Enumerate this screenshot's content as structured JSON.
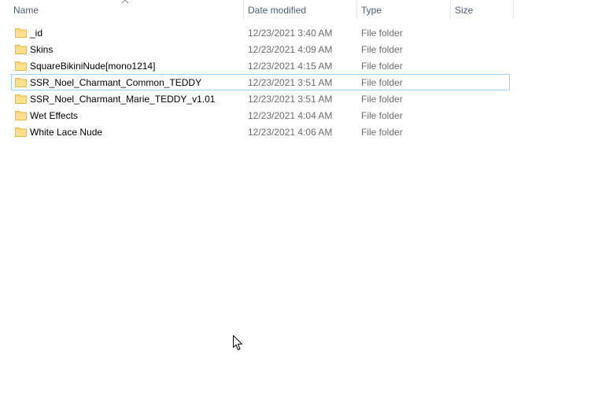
{
  "columns": {
    "name": "Name",
    "date": "Date modified",
    "type": "Type",
    "size": "Size"
  },
  "sort": {
    "column": "name",
    "direction": "ascending",
    "icon": "chevron-up-icon"
  },
  "folder_icon_color": "#ffd86b",
  "rows": [
    {
      "name": "_id",
      "date": "12/23/2021 3:40 AM",
      "type": "File folder",
      "size": ""
    },
    {
      "name": "Skins",
      "date": "12/23/2021 4:09 AM",
      "type": "File folder",
      "size": ""
    },
    {
      "name": "SquareBikiniNude[mono1214]",
      "date": "12/23/2021 4:15 AM",
      "type": "File folder",
      "size": ""
    },
    {
      "name": "SSR_Noel_Charmant_Common_TEDDY",
      "date": "12/23/2021 3:51 AM",
      "type": "File folder",
      "size": ""
    },
    {
      "name": "SSR_Noel_Charmant_Marie_TEDDY_v1.01",
      "date": "12/23/2021 3:51 AM",
      "type": "File folder",
      "size": ""
    },
    {
      "name": "Wet Effects",
      "date": "12/23/2021 4:04 AM",
      "type": "File folder",
      "size": ""
    },
    {
      "name": "White Lace Nude",
      "date": "12/23/2021 4:06 AM",
      "type": "File folder",
      "size": ""
    }
  ],
  "focused_row": 3,
  "cursor_icon": "mouse-pointer-icon"
}
